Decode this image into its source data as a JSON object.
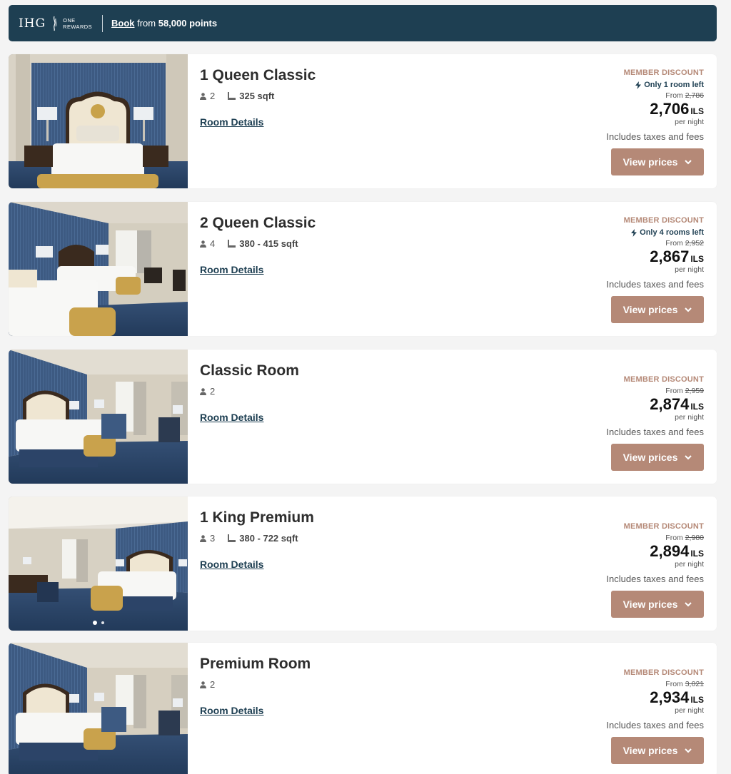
{
  "banner": {
    "logo_text": "IHG",
    "logo_sub_1": "ONE",
    "logo_sub_2": "REWARDS",
    "book_label": "Book",
    "from_label": "from",
    "points_text": "58,000 points"
  },
  "rooms": [
    {
      "name": "1 Queen Classic",
      "guests": "2",
      "size": "325 sqft",
      "details_label": "Room Details",
      "discount_label": "MEMBER DISCOUNT",
      "availability": "Only 1 room left",
      "from_label": "From",
      "original_price": "2,786",
      "price": "2,706",
      "currency": "ILS",
      "per_night": "per night",
      "taxes": "Includes taxes and fees",
      "button_label": "View prices"
    },
    {
      "name": "2 Queen Classic",
      "guests": "4",
      "size": "380 - 415 sqft",
      "details_label": "Room Details",
      "discount_label": "MEMBER DISCOUNT",
      "availability": "Only 4 rooms left",
      "from_label": "From",
      "original_price": "2,952",
      "price": "2,867",
      "currency": "ILS",
      "per_night": "per night",
      "taxes": "Includes taxes and fees",
      "button_label": "View prices"
    },
    {
      "name": "Classic Room",
      "guests": "2",
      "details_label": "Room Details",
      "discount_label": "MEMBER DISCOUNT",
      "from_label": "From",
      "original_price": "2,959",
      "price": "2,874",
      "currency": "ILS",
      "per_night": "per night",
      "taxes": "Includes taxes and fees",
      "button_label": "View prices"
    },
    {
      "name": "1 King Premium",
      "guests": "3",
      "size": "380 - 722 sqft",
      "details_label": "Room Details",
      "discount_label": "MEMBER DISCOUNT",
      "from_label": "From",
      "original_price": "2,980",
      "price": "2,894",
      "currency": "ILS",
      "per_night": "per night",
      "taxes": "Includes taxes and fees",
      "button_label": "View prices"
    },
    {
      "name": "Premium Room",
      "guests": "2",
      "details_label": "Room Details",
      "discount_label": "MEMBER DISCOUNT",
      "from_label": "From",
      "original_price": "3,021",
      "price": "2,934",
      "currency": "ILS",
      "per_night": "per night",
      "taxes": "Includes taxes and fees",
      "button_label": "View prices"
    }
  ],
  "colors": {
    "banner_bg": "#1e3f52",
    "accent": "#b58977",
    "wall_blue": "#3d5a82",
    "carpet_blue": "#2c4468"
  },
  "icons": {
    "guest": "person-icon",
    "size": "ruler-icon",
    "availability": "lightning-icon",
    "button": "chevron-down-icon"
  }
}
